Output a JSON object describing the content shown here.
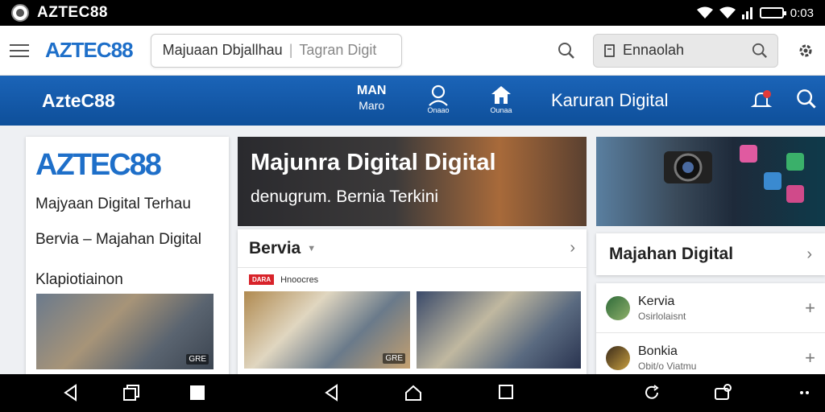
{
  "status_bar": {
    "app_title": "AZTEC88",
    "time": "0:03"
  },
  "header": {
    "brand": "AZTEC88",
    "search_text": "Majuaan Dbjallhau",
    "search_placeholder": "Tagran Digit",
    "search2_label": "Ennaolah"
  },
  "nav": {
    "brand": "AzteC88",
    "item1_top": "MAN",
    "item1_bottom": "Maro",
    "item2_caption": "Onaao",
    "item3_caption": "Ounaa",
    "text": "Karuran Digital"
  },
  "left_card": {
    "brand": "AZTEC88",
    "line1": "Majyaan Digital Terhau",
    "line2": "Bervia  –  Majahan Digital",
    "line3": "Klapiotiainon",
    "photo_badge": "GRE"
  },
  "hero": {
    "title": "Majunra Digital Digital",
    "subtitle": "denugrum. Bernia Terkini"
  },
  "mid_card": {
    "section_title": "Bervia",
    "tag": "DARA",
    "tag_text": "Hnoocres",
    "photo_badge": "GRE"
  },
  "right": {
    "section_title": "Majahan Digital",
    "items": [
      {
        "title": "Kervia",
        "sub": "Osirlolaisnt"
      },
      {
        "title": "Bonkia",
        "sub": "Obit/o Viatmu"
      }
    ]
  },
  "colors": {
    "brand_blue": "#1e6fc9",
    "nav_blue": "#1b64b8",
    "tag_red": "#d8232a"
  }
}
